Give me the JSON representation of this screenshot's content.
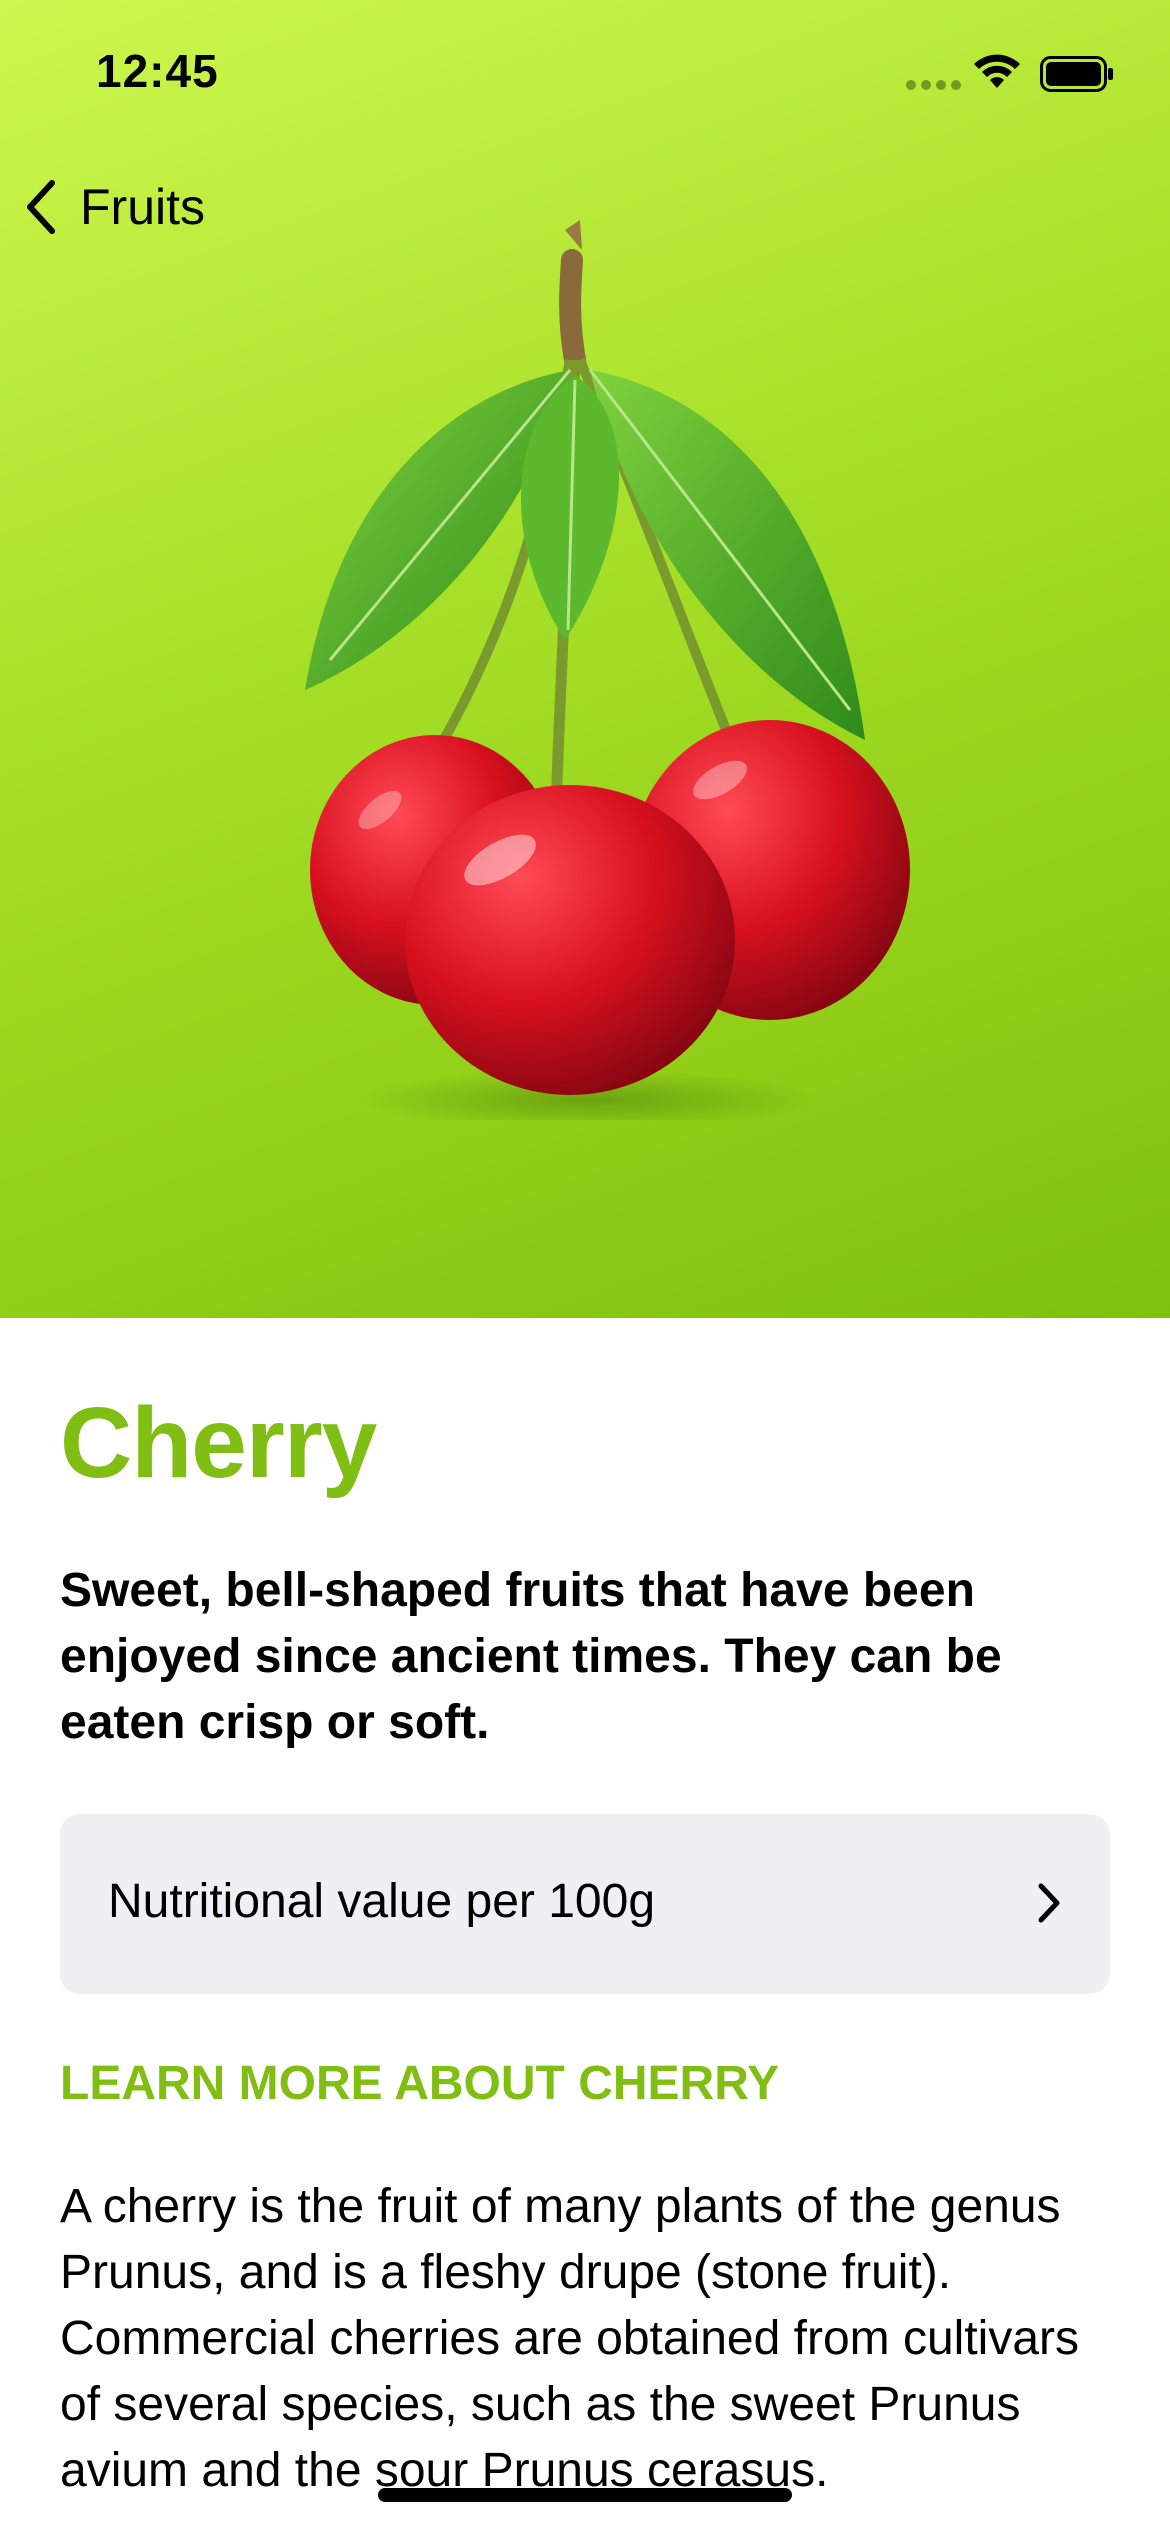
{
  "status_bar": {
    "time": "12:45"
  },
  "navigation": {
    "back_label": "Fruits"
  },
  "hero": {
    "image": "cherry-with-leaves",
    "background_colors": [
      "#cdf74e",
      "#a6df27",
      "#7fc10c"
    ]
  },
  "fruit": {
    "name": "Cherry",
    "headline": "Sweet, bell-shaped fruits that have been enjoyed since ancient times. They can be eaten crisp or soft.",
    "nutrition_label": "Nutritional value per 100g",
    "learn_more_header": "LEARN MORE ABOUT CHERRY",
    "description": "A cherry is the fruit of many plants of the genus Prunus, and is a fleshy drupe (stone fruit). Commercial cherries are obtained from cultivars of several species, such as the sweet Prunus avium and the sour Prunus cerasus."
  },
  "colors": {
    "accent": "#80be13",
    "row_background": "#efeff4"
  }
}
